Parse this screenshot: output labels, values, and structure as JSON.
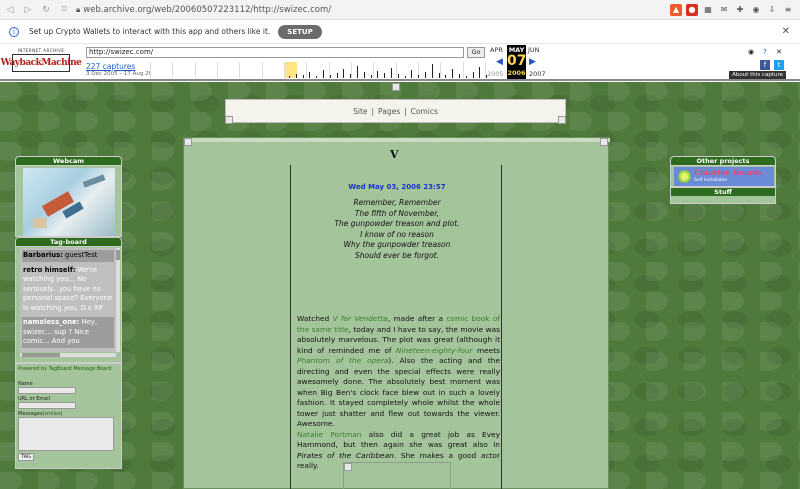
{
  "browser": {
    "url": "web.archive.org/web/20060507223112/http://swizec.com/"
  },
  "banner": {
    "text": "Set up Crypto Wallets to interact with this app and others like it.",
    "setup_label": "SETUP"
  },
  "wayback": {
    "logo_top": "INTERNET ARCHIVE",
    "logo_text": "WaybackMachine",
    "url_value": "http://swizec.com/",
    "go_label": "Go",
    "captures": "227 captures",
    "date_range": "3 Dec 2005 – 17 Aug 2020",
    "prev_month": "APR",
    "cur_month": "MAY",
    "next_month": "JUN",
    "cur_day": "07",
    "cur_year": "2006",
    "prev_year": "2005",
    "next_year": "2007",
    "about": "About this capture"
  },
  "nav": {
    "site": "Site",
    "sep1": "|",
    "pages": "Pages",
    "sep2": "|",
    "comics": "Comics"
  },
  "post": {
    "title": "V",
    "date": "Wed May 03, 2006 23:57",
    "poem": [
      "Remember, Remember",
      "The fifth of November,",
      "The gunpowder treason and plot.",
      "I know of no reason",
      "Why the gunpowder treason",
      "Should ever be forgot."
    ],
    "p1_a": "Watched ",
    "p1_movie": "V for Vendetta",
    "p1_b": ", made after a ",
    "p1_link": "comic book of the same title",
    "p1_c": ", today and I have to say, the movie was absolutely marvelous. The plot was great (although it kind of reminded me of ",
    "p1_link2": "Nineteen-eighty-four",
    "p1_d": " meets ",
    "p1_link3": "Phantom of the opera",
    "p1_e": "). Also the acting and the directing and even the special effects were really awesomely done. The absolutely best moment was when Big Ben's clock face blew out in such a lovely fashion. It stayed completely whole whilst the whole tower just shatter and flew out towards the viewer. Awesome.",
    "p2_link": "Natalie Portman",
    "p2_a": " also did a great job as Evey Hammond, but then again she was great also in ",
    "p2_em": "Pirates of the Caribbean",
    "p2_b": ". She makes a good actor really."
  },
  "sidebar_left": {
    "webcam_title": "Webcam",
    "tagboard_title": "Tag-board",
    "entries": [
      {
        "name": "Barbarius:",
        "msg": " guestTest"
      },
      {
        "name": "retro himself:",
        "msg": " We're watching you... No seriously...you have no personal space? Everyone is watching you. O.o XP"
      },
      {
        "name": "nameless_one:",
        "msg": " Hey, swizec... sup ? Nice comic... And you"
      }
    ],
    "powered": "Powered by TagBoard Message Board",
    "name_label": "Name",
    "url_label": "URL or Email",
    "messages_label": "Messages(",
    "smiles_label": "smiles",
    "messages_end": ")",
    "tag_button": "TAG"
  },
  "sidebar_right": {
    "other_title": "Other projects",
    "banner_title": "Chlorine Boards",
    "banner_sub": "Self installable",
    "stuff_title": "Stuff"
  }
}
